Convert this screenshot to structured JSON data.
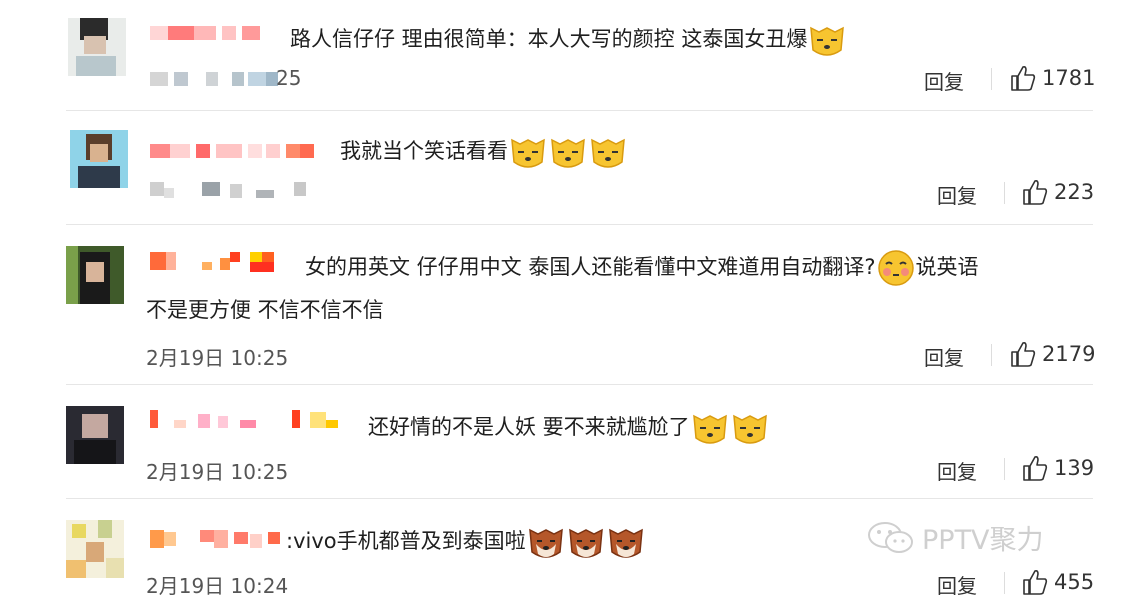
{
  "comments": [
    {
      "text": "路人信仔仔 理由很简单：本人大写的颜控 这泰国女丑爆",
      "text2": "",
      "time": "",
      "time_tail": "25",
      "reply": "回复",
      "likes": "1781"
    },
    {
      "text": "我就当个笑话看看",
      "text2": "",
      "time": "",
      "reply": "回复",
      "likes": "223"
    },
    {
      "text": "女的用英文 仔仔用中文 泰国人还能看懂中文难道用自动翻译?",
      "text_after": "说英语",
      "text2": "不是更方便 不信不信不信",
      "time": "2月19日 10:25",
      "reply": "回复",
      "likes": "2179"
    },
    {
      "text": "还好情的不是人妖 要不来就尴尬了",
      "text2": "",
      "time": "2月19日 10:25",
      "reply": "回复",
      "likes": "139"
    },
    {
      "text": ":vivo手机都普及到泰国啦",
      "text2": "",
      "time": "2月19日 10:24",
      "reply": "回复",
      "likes": "455"
    }
  ],
  "watermark": "PPTV聚力",
  "colors": {
    "emoji_yellow": "#f7c530",
    "emoji_brown": "#b5572a",
    "like_text": "#333333"
  }
}
